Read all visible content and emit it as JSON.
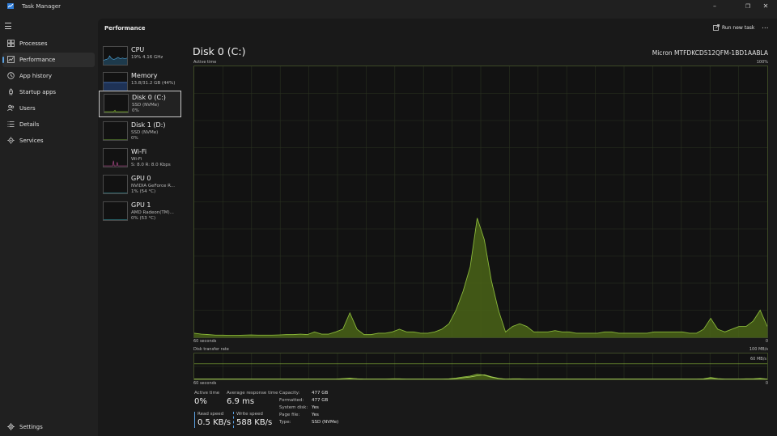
{
  "window": {
    "title": "Task Manager"
  },
  "nav": {
    "items": [
      {
        "label": "Processes",
        "icon": "processes-icon"
      },
      {
        "label": "Performance",
        "icon": "performance-icon"
      },
      {
        "label": "App history",
        "icon": "app-history-icon"
      },
      {
        "label": "Startup apps",
        "icon": "startup-apps-icon"
      },
      {
        "label": "Users",
        "icon": "users-icon"
      },
      {
        "label": "Details",
        "icon": "details-icon"
      },
      {
        "label": "Services",
        "icon": "services-icon"
      }
    ],
    "settings_label": "Settings",
    "active_index": 1
  },
  "header": {
    "title": "Performance",
    "run_new_task": "Run new task",
    "more": "..."
  },
  "devices": [
    {
      "name": "CPU",
      "sub1": "19%  4.16 GHz",
      "sub2": "",
      "color": "#4ea5d9"
    },
    {
      "name": "Memory",
      "sub1": "13.8/31.2 GB (44%)",
      "sub2": "",
      "color": "#4a7cc9"
    },
    {
      "name": "Disk 0 (C:)",
      "sub1": "SSD (NVMe)",
      "sub2": "0%",
      "color": "#6ea03a"
    },
    {
      "name": "Disk 1 (D:)",
      "sub1": "SSD (NVMe)",
      "sub2": "0%",
      "color": "#6ea03a"
    },
    {
      "name": "Wi-Fi",
      "sub1": "Wi-Fi",
      "sub2": "S: 8.0  R: 8.0 Kbps",
      "color": "#b04a8c"
    },
    {
      "name": "GPU 0",
      "sub1": "NVIDIA GeForce R...",
      "sub2": "1%  (54 °C)",
      "color": "#3da6b5"
    },
    {
      "name": "GPU 1",
      "sub1": "AMD Radeon(TM)...",
      "sub2": "0%  (53 °C)",
      "color": "#3da6b5"
    }
  ],
  "selected_device": 2,
  "detail": {
    "title": "Disk 0 (C:)",
    "model": "Micron MTFDKCD512QFM-1BD1AABLA",
    "active_graph": {
      "label": "Active time",
      "max_label": "100%",
      "x_label": "60 seconds",
      "min_label": "0",
      "values": [
        1.5,
        1.2,
        1,
        0.8,
        0.8,
        0.7,
        0.7,
        0.8,
        0.9,
        0.8,
        0.8,
        0.8,
        0.9,
        1,
        1,
        1.2,
        1,
        2,
        1.2,
        1.2,
        2,
        3,
        9,
        3,
        1,
        1,
        1.5,
        1.5,
        2,
        3,
        2,
        2,
        1.5,
        1.5,
        2,
        3,
        5,
        10,
        17,
        26,
        44,
        36,
        21,
        10,
        2,
        4,
        5,
        4,
        2,
        2,
        2,
        2.5,
        2,
        2,
        1.5,
        1.5,
        1.5,
        1.5,
        2,
        2,
        1.5,
        1.5,
        1.5,
        1.5,
        1.5,
        2,
        2,
        2,
        2,
        2,
        1.5,
        1.5,
        3,
        7,
        3,
        2,
        3,
        4,
        4,
        6,
        10,
        4
      ]
    },
    "transfer_graph": {
      "label": "Disk transfer rate",
      "max_label": "100 MB/s",
      "mid_label": "60 MB/s",
      "x_label": "60 seconds",
      "min_label": "0",
      "read_values": [
        1,
        1,
        1,
        1,
        1,
        1,
        1,
        1,
        1,
        1,
        1,
        1,
        1,
        1,
        1,
        1,
        1,
        1,
        1,
        1,
        1,
        2,
        3,
        2,
        1,
        1,
        1,
        1,
        1,
        1,
        1,
        1,
        1,
        1,
        1,
        1,
        1,
        3,
        6,
        9,
        14,
        18,
        10,
        4,
        1,
        1,
        1,
        1,
        1,
        1,
        1,
        1,
        1,
        1,
        1,
        1,
        1,
        1,
        1,
        1,
        1,
        1,
        1,
        1,
        1,
        1,
        1,
        1,
        1,
        1,
        1,
        1,
        1,
        4,
        2,
        1,
        1,
        1,
        1,
        1,
        2,
        1
      ],
      "write_values": [
        1,
        1,
        1,
        1,
        1,
        1,
        1,
        1,
        1,
        1,
        1,
        1,
        1,
        1,
        1,
        1,
        1,
        1,
        1,
        1,
        1,
        3,
        5,
        2,
        1,
        1,
        1,
        1,
        2,
        2,
        1,
        1,
        1,
        1,
        1,
        1,
        2,
        5,
        9,
        13,
        20,
        16,
        8,
        3,
        1,
        2,
        2,
        1,
        1,
        1,
        1,
        1,
        1,
        1,
        1,
        1,
        1,
        1,
        1,
        1,
        1,
        1,
        1,
        1,
        1,
        1,
        1,
        1,
        1,
        1,
        1,
        1,
        2,
        7,
        3,
        1,
        1,
        1,
        2,
        2,
        4,
        1
      ]
    },
    "stats": {
      "active_time_label": "Active time",
      "active_time_value": "0%",
      "avg_response_label": "Average response time",
      "avg_response_value": "6.9 ms",
      "read_speed_label": "Read speed",
      "read_speed_value": "0.5 KB/s",
      "write_speed_label": "Write speed",
      "write_speed_value": "588 KB/s"
    },
    "properties": [
      {
        "key": "Capacity:",
        "value": "477 GB"
      },
      {
        "key": "Formatted:",
        "value": "477 GB"
      },
      {
        "key": "System disk:",
        "value": "Yes"
      },
      {
        "key": "Page file:",
        "value": "Yes"
      },
      {
        "key": "Type:",
        "value": "SSD (NVMe)"
      }
    ]
  },
  "colors": {
    "accent": "#5aa0e0",
    "disk_line": "#8ab83a",
    "disk_fill": "#4a6418",
    "grid": "#2a3320"
  }
}
